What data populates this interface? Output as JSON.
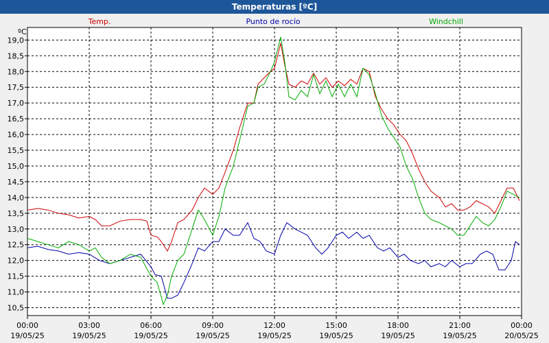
{
  "window": {
    "title": "Temperaturas [ºC]"
  },
  "chart_data": {
    "type": "line",
    "title": "Temperaturas [ºC]",
    "ylabel": "ºC",
    "ylim": [
      10.25,
      19.4
    ],
    "yticks": [
      "19,0",
      "18,5",
      "18,0",
      "17,5",
      "17,0",
      "16,5",
      "16,0",
      "15,5",
      "15,0",
      "14,5",
      "14,0",
      "13,5",
      "13,0",
      "12,5",
      "12,0",
      "11,5",
      "11,0",
      "10,5"
    ],
    "ytick_values": [
      19.0,
      18.5,
      18.0,
      17.5,
      17.0,
      16.5,
      16.0,
      15.5,
      15.0,
      14.5,
      14.0,
      13.5,
      13.0,
      12.5,
      12.0,
      11.5,
      11.0,
      10.5
    ],
    "xlim": [
      0,
      24
    ],
    "xticks": [
      {
        "time": "00:00",
        "date": "19/05/25",
        "h": 0
      },
      {
        "time": "03:00",
        "date": "19/05/25",
        "h": 3
      },
      {
        "time": "06:00",
        "date": "19/05/25",
        "h": 6
      },
      {
        "time": "09:00",
        "date": "19/05/25",
        "h": 9
      },
      {
        "time": "12:00",
        "date": "19/05/25",
        "h": 12
      },
      {
        "time": "15:00",
        "date": "19/05/25",
        "h": 15
      },
      {
        "time": "18:00",
        "date": "19/05/25",
        "h": 18
      },
      {
        "time": "21:00",
        "date": "19/05/25",
        "h": 21
      },
      {
        "time": "00:00",
        "date": "20/05/25",
        "h": 24
      }
    ],
    "grid": true,
    "legend_placement": "top",
    "series": [
      {
        "name": "Temp.",
        "color": "#cc0000",
        "points": [
          [
            0,
            13.6
          ],
          [
            0.5,
            13.65
          ],
          [
            1,
            13.6
          ],
          [
            1.5,
            13.5
          ],
          [
            2,
            13.45
          ],
          [
            2.5,
            13.35
          ],
          [
            3,
            13.4
          ],
          [
            3.3,
            13.3
          ],
          [
            3.6,
            13.1
          ],
          [
            4,
            13.1
          ],
          [
            4.5,
            13.25
          ],
          [
            5,
            13.3
          ],
          [
            5.5,
            13.3
          ],
          [
            5.8,
            13.25
          ],
          [
            6,
            12.8
          ],
          [
            6.3,
            12.75
          ],
          [
            6.5,
            12.6
          ],
          [
            6.8,
            12.3
          ],
          [
            7,
            12.6
          ],
          [
            7.3,
            13.2
          ],
          [
            7.6,
            13.3
          ],
          [
            8,
            13.6
          ],
          [
            8.3,
            14.0
          ],
          [
            8.6,
            14.3
          ],
          [
            9,
            14.1
          ],
          [
            9.3,
            14.3
          ],
          [
            9.6,
            14.8
          ],
          [
            10,
            15.5
          ],
          [
            10.3,
            16.2
          ],
          [
            10.7,
            17.0
          ],
          [
            11,
            17.0
          ],
          [
            11.2,
            17.6
          ],
          [
            11.5,
            17.8
          ],
          [
            11.8,
            18.0
          ],
          [
            12,
            18.1
          ],
          [
            12.3,
            18.9
          ],
          [
            12.5,
            18.2
          ],
          [
            12.7,
            17.6
          ],
          [
            13,
            17.5
          ],
          [
            13.3,
            17.7
          ],
          [
            13.6,
            17.6
          ],
          [
            13.9,
            17.95
          ],
          [
            14.2,
            17.6
          ],
          [
            14.5,
            17.8
          ],
          [
            14.8,
            17.5
          ],
          [
            15.1,
            17.7
          ],
          [
            15.4,
            17.55
          ],
          [
            15.7,
            17.75
          ],
          [
            16,
            17.6
          ],
          [
            16.3,
            18.1
          ],
          [
            16.6,
            18.0
          ],
          [
            16.9,
            17.2
          ],
          [
            17.2,
            16.8
          ],
          [
            17.5,
            16.5
          ],
          [
            17.8,
            16.3
          ],
          [
            18.1,
            16.0
          ],
          [
            18.4,
            15.8
          ],
          [
            18.7,
            15.4
          ],
          [
            19,
            14.9
          ],
          [
            19.3,
            14.5
          ],
          [
            19.6,
            14.2
          ],
          [
            20,
            14.0
          ],
          [
            20.3,
            13.7
          ],
          [
            20.6,
            13.8
          ],
          [
            20.9,
            13.6
          ],
          [
            21.2,
            13.6
          ],
          [
            21.5,
            13.7
          ],
          [
            21.8,
            13.9
          ],
          [
            22.1,
            13.8
          ],
          [
            22.4,
            13.7
          ],
          [
            22.7,
            13.5
          ],
          [
            23,
            13.9
          ],
          [
            23.3,
            14.3
          ],
          [
            23.6,
            14.3
          ],
          [
            23.9,
            13.9
          ]
        ]
      },
      {
        "name": "Punto de rocío",
        "color": "#0000aa",
        "points": [
          [
            0,
            12.4
          ],
          [
            0.5,
            12.45
          ],
          [
            1,
            12.35
          ],
          [
            1.5,
            12.3
          ],
          [
            2,
            12.2
          ],
          [
            2.5,
            12.25
          ],
          [
            3,
            12.2
          ],
          [
            3.5,
            12.0
          ],
          [
            4,
            11.9
          ],
          [
            4.5,
            12.0
          ],
          [
            5,
            12.1
          ],
          [
            5.5,
            12.2
          ],
          [
            6,
            11.8
          ],
          [
            6.2,
            11.55
          ],
          [
            6.5,
            11.5
          ],
          [
            6.8,
            10.8
          ],
          [
            7,
            10.8
          ],
          [
            7.3,
            10.9
          ],
          [
            7.6,
            11.3
          ],
          [
            8,
            11.9
          ],
          [
            8.3,
            12.4
          ],
          [
            8.6,
            12.3
          ],
          [
            9,
            12.6
          ],
          [
            9.3,
            12.6
          ],
          [
            9.6,
            13.0
          ],
          [
            10,
            12.8
          ],
          [
            10.3,
            12.8
          ],
          [
            10.7,
            13.2
          ],
          [
            11,
            12.7
          ],
          [
            11.3,
            12.6
          ],
          [
            11.6,
            12.3
          ],
          [
            12,
            12.2
          ],
          [
            12.3,
            12.8
          ],
          [
            12.6,
            13.2
          ],
          [
            13,
            13.0
          ],
          [
            13.3,
            12.9
          ],
          [
            13.6,
            12.8
          ],
          [
            14,
            12.4
          ],
          [
            14.3,
            12.2
          ],
          [
            14.6,
            12.4
          ],
          [
            15,
            12.8
          ],
          [
            15.3,
            12.9
          ],
          [
            15.6,
            12.7
          ],
          [
            16,
            12.9
          ],
          [
            16.3,
            12.7
          ],
          [
            16.6,
            12.8
          ],
          [
            17,
            12.4
          ],
          [
            17.3,
            12.3
          ],
          [
            17.6,
            12.4
          ],
          [
            18,
            12.1
          ],
          [
            18.3,
            12.2
          ],
          [
            18.6,
            12.0
          ],
          [
            19,
            11.9
          ],
          [
            19.3,
            12.0
          ],
          [
            19.6,
            11.8
          ],
          [
            20,
            11.9
          ],
          [
            20.3,
            11.8
          ],
          [
            20.6,
            12.0
          ],
          [
            21,
            11.8
          ],
          [
            21.3,
            11.9
          ],
          [
            21.6,
            11.9
          ],
          [
            22,
            12.2
          ],
          [
            22.3,
            12.3
          ],
          [
            22.6,
            12.2
          ],
          [
            22.9,
            11.7
          ],
          [
            23.2,
            11.7
          ],
          [
            23.5,
            12.0
          ],
          [
            23.7,
            12.6
          ],
          [
            23.9,
            12.5
          ]
        ]
      },
      {
        "name": "Windchill",
        "color": "#00aa00",
        "points": [
          [
            0,
            12.7
          ],
          [
            0.5,
            12.6
          ],
          [
            1,
            12.5
          ],
          [
            1.5,
            12.4
          ],
          [
            2,
            12.6
          ],
          [
            2.5,
            12.5
          ],
          [
            3,
            12.3
          ],
          [
            3.3,
            12.4
          ],
          [
            3.6,
            12.1
          ],
          [
            4,
            11.9
          ],
          [
            4.5,
            12.0
          ],
          [
            5,
            12.2
          ],
          [
            5.5,
            12.1
          ],
          [
            6,
            11.5
          ],
          [
            6.3,
            11.3
          ],
          [
            6.6,
            10.6
          ],
          [
            6.8,
            10.9
          ],
          [
            7,
            11.5
          ],
          [
            7.3,
            12.0
          ],
          [
            7.6,
            12.2
          ],
          [
            8,
            13.0
          ],
          [
            8.3,
            13.6
          ],
          [
            8.6,
            13.3
          ],
          [
            9,
            12.8
          ],
          [
            9.3,
            13.4
          ],
          [
            9.6,
            14.3
          ],
          [
            10,
            15.0
          ],
          [
            10.3,
            15.8
          ],
          [
            10.7,
            16.9
          ],
          [
            11,
            17.0
          ],
          [
            11.2,
            17.5
          ],
          [
            11.5,
            17.6
          ],
          [
            11.8,
            18.0
          ],
          [
            12,
            18.3
          ],
          [
            12.3,
            19.1
          ],
          [
            12.5,
            18.3
          ],
          [
            12.7,
            17.2
          ],
          [
            13,
            17.1
          ],
          [
            13.3,
            17.4
          ],
          [
            13.6,
            17.2
          ],
          [
            13.9,
            17.9
          ],
          [
            14.2,
            17.3
          ],
          [
            14.5,
            17.7
          ],
          [
            14.8,
            17.2
          ],
          [
            15.1,
            17.6
          ],
          [
            15.4,
            17.2
          ],
          [
            15.7,
            17.6
          ],
          [
            16,
            17.2
          ],
          [
            16.3,
            18.1
          ],
          [
            16.6,
            17.9
          ],
          [
            16.9,
            17.3
          ],
          [
            17.2,
            16.6
          ],
          [
            17.5,
            16.2
          ],
          [
            17.8,
            15.9
          ],
          [
            18.1,
            15.6
          ],
          [
            18.4,
            15.0
          ],
          [
            18.7,
            14.6
          ],
          [
            19,
            14.0
          ],
          [
            19.3,
            13.5
          ],
          [
            19.6,
            13.3
          ],
          [
            20,
            13.2
          ],
          [
            20.3,
            13.1
          ],
          [
            20.6,
            13.0
          ],
          [
            20.9,
            12.8
          ],
          [
            21.2,
            12.8
          ],
          [
            21.5,
            13.1
          ],
          [
            21.8,
            13.4
          ],
          [
            22.1,
            13.2
          ],
          [
            22.4,
            13.1
          ],
          [
            22.7,
            13.3
          ],
          [
            23,
            13.7
          ],
          [
            23.3,
            14.2
          ],
          [
            23.6,
            14.1
          ],
          [
            23.9,
            14.0
          ]
        ]
      }
    ]
  }
}
